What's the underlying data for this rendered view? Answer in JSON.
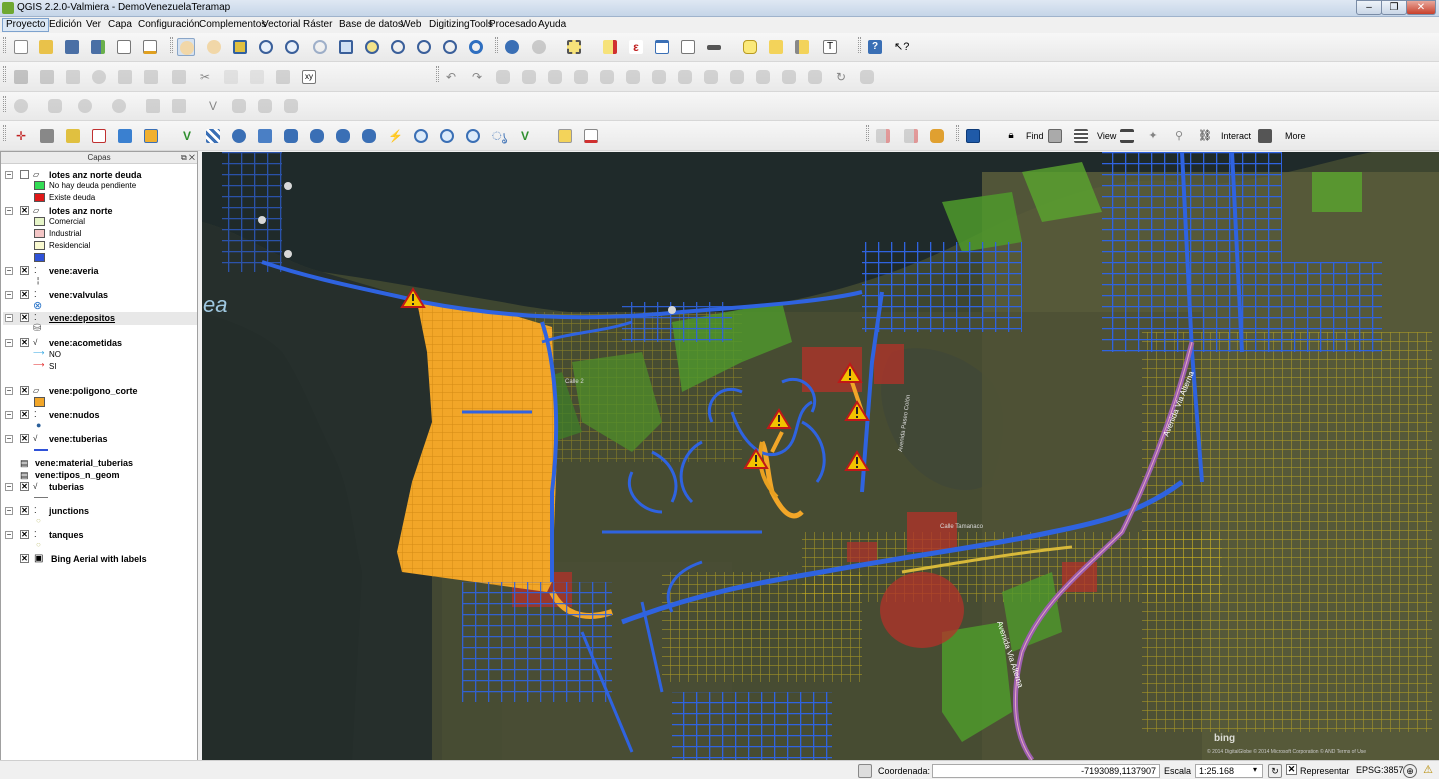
{
  "window": {
    "title": "QGIS 2.2.0-Valmiera - DemoVenezuelaTeramap"
  },
  "menu": [
    "Proyecto",
    "Edición",
    "Ver",
    "Capa",
    "Configuración",
    "Complementos",
    "Vectorial",
    "Ráster",
    "Base de datos",
    "Web",
    "DigitizingTools",
    "Procesado",
    "Ayuda"
  ],
  "toolbar": {
    "find_label": "Find",
    "view_label": "View",
    "interact_label": "Interact",
    "more_label": "More"
  },
  "layers_panel": {
    "title": "Capas",
    "layers": [
      {
        "name": "lotes anz norte deuda",
        "checked": false,
        "legend": [
          {
            "label": "No hay deuda pendiente",
            "color": "#33dd55"
          },
          {
            "label": "Existe deuda",
            "color": "#e01818"
          }
        ]
      },
      {
        "name": "lotes anz norte",
        "checked": true,
        "legend": [
          {
            "label": "Comercial",
            "color": "#e6f5c8"
          },
          {
            "label": "Industrial",
            "color": "#f4c6c6"
          },
          {
            "label": "Residencial",
            "color": "#fafad0"
          },
          {
            "label": "",
            "color": "#2f52d8"
          }
        ]
      },
      {
        "name": "vene:averia",
        "checked": true
      },
      {
        "name": "vene:valvulas",
        "checked": true
      },
      {
        "name": "vene:depositos",
        "checked": true
      },
      {
        "name": "vene:acometidas",
        "checked": true,
        "legend": [
          {
            "label": "NO",
            "color": "#2ea3e0"
          },
          {
            "label": "SI",
            "color": "#e02020"
          }
        ]
      },
      {
        "name": "vene:poligono_corte",
        "checked": true,
        "legend": [
          {
            "label": "",
            "color": "#f2a628"
          }
        ]
      },
      {
        "name": "vene:nudos",
        "checked": true
      },
      {
        "name": "vene:tuberias",
        "checked": true
      },
      {
        "name": "vene:material_tuberias"
      },
      {
        "name": "vene:tipos_n_geom"
      },
      {
        "name": "tuberias",
        "checked": true
      },
      {
        "name": "junctions",
        "checked": true
      },
      {
        "name": "tanques",
        "checked": true
      },
      {
        "name": "Bing Aerial with labels",
        "checked": true
      }
    ]
  },
  "map": {
    "labels": [
      "ea",
      "Calle 2",
      "Avenida Paseo Colón",
      "Avenida Via Alterna",
      "Avenida Via Alterna",
      "Calle Tamanaco"
    ],
    "attribution": "© 2014 DigitalGlobe © 2014 Microsoft Corporation © AND Terms of Use",
    "bing_logo": "bing"
  },
  "statusbar": {
    "coord_label": "Coordenada:",
    "coord_value": "-7193089,1137907",
    "scale_label": "Escala",
    "scale_value": "1:25.168",
    "render_label": "Representar",
    "crs": "EPSG:3857"
  }
}
